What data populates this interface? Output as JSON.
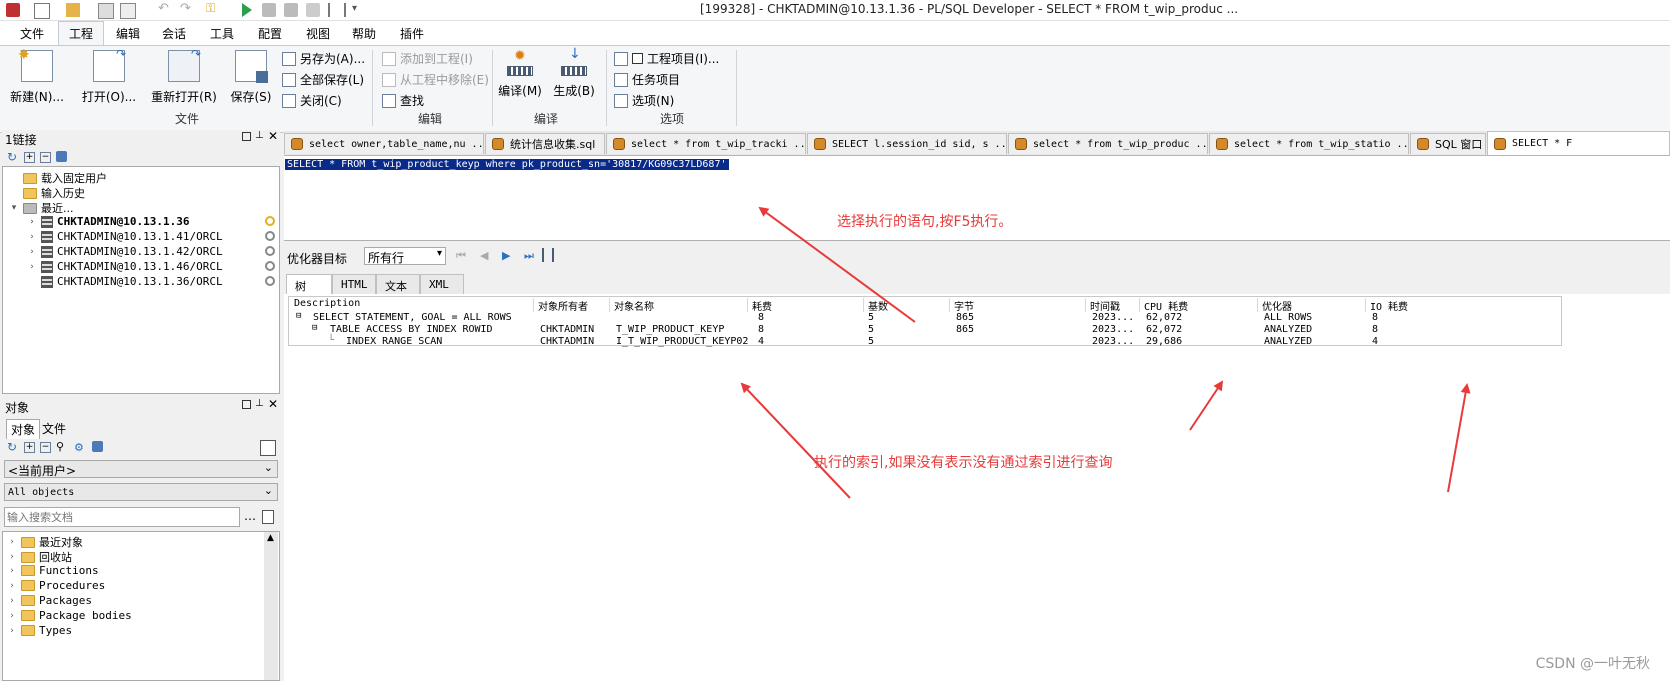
{
  "titlebar": {
    "title": "[199328] - CHKTADMIN@10.13.1.36 - PL/SQL Developer - SELECT * FROM t_wip_produc ..."
  },
  "menu": [
    "文件",
    "工程",
    "编辑",
    "会话",
    "工具",
    "配置",
    "视图",
    "帮助",
    "插件"
  ],
  "ribbon": {
    "new": "新建(N)...",
    "open": "打开(O)...",
    "reopen": "重新打开(R)",
    "save": "保存(S)",
    "save_as": "另存为(A)...",
    "save_all": "全部保存(L)",
    "close": "关闭(C)",
    "group_file": "文件",
    "add_to_project": "添加到工程(I)",
    "remove_from_project": "从工程中移除(E)",
    "find": "查找",
    "group_edit": "编辑",
    "compile": "编译(M)",
    "build": "生成(B)",
    "group_compile": "编译",
    "project_items": "工程项目(I)...",
    "task_items": "任务项目",
    "options": "选项(N)",
    "group_options": "选项"
  },
  "connections": {
    "title": "1链接",
    "items": [
      "载入固定用户",
      "输入历史",
      "最近..."
    ],
    "recent": [
      "CHKTADMIN@10.13.1.36",
      "CHKTADMIN@10.13.1.41/ORCL",
      "CHKTADMIN@10.13.1.42/ORCL",
      "CHKTADMIN@10.13.1.46/ORCL",
      "CHKTADMIN@10.13.1.36/ORCL"
    ]
  },
  "objects": {
    "title": "对象",
    "tab_objects": "对象",
    "tab_files": "文件",
    "current_user": "<当前用户>",
    "filter": "All objects",
    "search_placeholder": "输入搜索文档",
    "tree": [
      "最近对象",
      "回收站",
      "Functions",
      "Procedures",
      "Packages",
      "Package bodies",
      "Types"
    ]
  },
  "editor_tabs": [
    "select owner,table_name,nu ...",
    "统计信息收集.sql",
    "select * from t_wip_tracki ...",
    "SELECT l.session_id sid, s ...",
    "select * from t_wip_produc ...",
    "select * from t_wip_statio ...",
    "SQL 窗口",
    "SELECT * F"
  ],
  "sql": "SELECT * FROM t_wip_product_keyp  where pk_product_sn='30817/KG09C37LD687'",
  "plan": {
    "optimizer_label": "优化器目标",
    "optimizer_value": "所有行",
    "subtabs": [
      "树",
      "HTML",
      "文本",
      "XML"
    ],
    "columns": [
      "Description",
      "对象所有者",
      "对象名称",
      "耗费",
      "基数",
      "字节",
      "时间戳",
      "CPU 耗费",
      "优化器",
      "IO 耗费"
    ],
    "rows": [
      [
        "SELECT STATEMENT, GOAL = ALL ROWS",
        "",
        "",
        "8",
        "5",
        "865",
        "2023...",
        "62,072",
        "ALL ROWS",
        "8"
      ],
      [
        "TABLE ACCESS BY INDEX ROWID",
        "CHKTADMIN",
        "T_WIP_PRODUCT_KEYP",
        "8",
        "5",
        "865",
        "2023...",
        "62,072",
        "ANALYZED",
        "8"
      ],
      [
        "INDEX RANGE SCAN",
        "CHKTADMIN",
        "I_T_WIP_PRODUCT_KEYP02",
        "4",
        "5",
        "",
        "2023...",
        "29,686",
        "ANALYZED",
        "4"
      ]
    ]
  },
  "annotations": {
    "a1": "选择执行的语句,按F5执行。",
    "a2": "执行的索引,如果没有表示没有通过索引进行查询"
  },
  "watermark": "CSDN @一叶无秋",
  "colors": {
    "annotation": "#e83a3a",
    "selection": "#0a2a8a"
  }
}
